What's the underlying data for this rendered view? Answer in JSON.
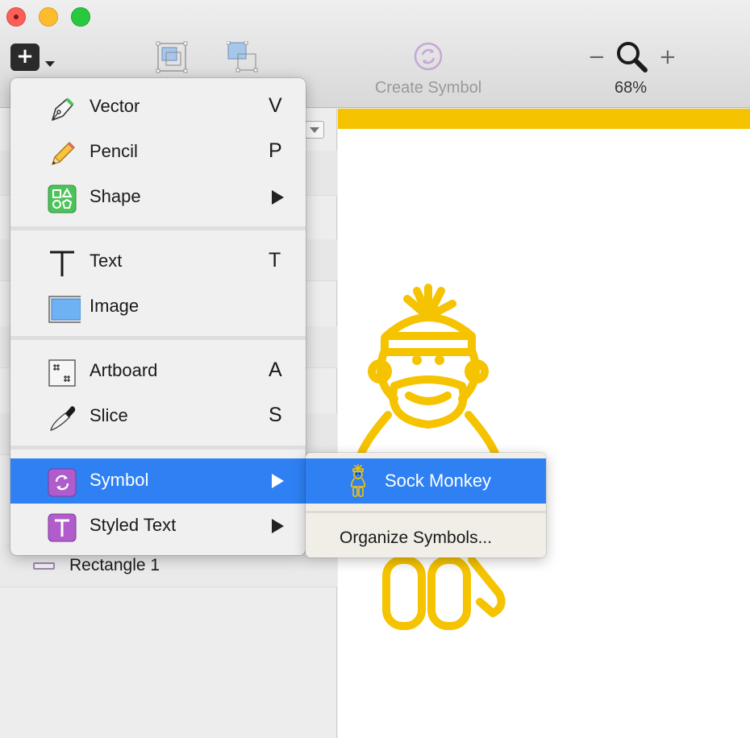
{
  "colors": {
    "accent": "#2f80f3",
    "artboard_yellow": "#f5c300",
    "symbol_purple": "#b05ccc",
    "shape_green": "#4cc35a"
  },
  "toolbar": {
    "insert_label": "+",
    "create_symbol_label": "Create Symbol",
    "zoom_minus": "−",
    "zoom_plus": "+",
    "zoom_level": "68%",
    "icons": [
      "group-icon",
      "ungroup-icon",
      "create-symbol-icon",
      "zoom-icon"
    ]
  },
  "insert_menu": {
    "items": [
      {
        "label": "Vector",
        "shortcut": "V",
        "icon": "pen-icon"
      },
      {
        "label": "Pencil",
        "shortcut": "P",
        "icon": "pencil-icon"
      },
      {
        "label": "Shape",
        "submenu": true,
        "icon": "shape-icon"
      },
      {
        "label": "Text",
        "shortcut": "T",
        "icon": "text-icon"
      },
      {
        "label": "Image",
        "icon": "image-icon"
      },
      {
        "label": "Artboard",
        "shortcut": "A",
        "icon": "artboard-icon"
      },
      {
        "label": "Slice",
        "shortcut": "S",
        "icon": "knife-icon"
      },
      {
        "label": "Symbol",
        "submenu": true,
        "icon": "symbol-icon",
        "active": true
      },
      {
        "label": "Styled Text",
        "submenu": true,
        "icon": "styled-text-icon"
      }
    ]
  },
  "symbol_submenu": {
    "items": [
      {
        "label": "Sock Monkey",
        "icon": "sock-monkey-icon",
        "active": true
      },
      {
        "label": "Organize Symbols..."
      }
    ]
  },
  "sidebar": {
    "layers": [
      {
        "label": "Rectangle 1",
        "icon": "rectangle-icon"
      }
    ]
  }
}
